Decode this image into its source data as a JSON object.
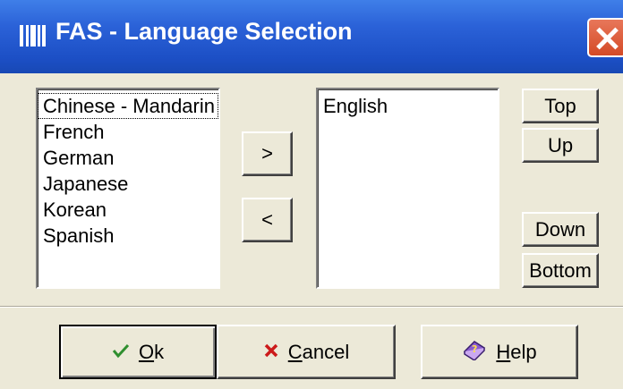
{
  "window": {
    "title": "FAS - Language Selection",
    "accent": "#2b62d8"
  },
  "available": {
    "items": [
      "Chinese - Mandarin",
      "French",
      "German",
      "Japanese",
      "Korean",
      "Spanish"
    ]
  },
  "selected": {
    "items": [
      "English"
    ]
  },
  "move": {
    "add_label": ">",
    "remove_label": "<"
  },
  "order": {
    "top_label": "Top",
    "up_label": "Up",
    "down_label": "Down",
    "bottom_label": "Bottom"
  },
  "footer": {
    "ok": {
      "label": "Ok",
      "icon": "checkmark-icon",
      "mnemonic": "O"
    },
    "cancel": {
      "label": "Cancel",
      "icon": "x-icon",
      "mnemonic": "C"
    },
    "help": {
      "label": "Help",
      "icon": "help-book-icon",
      "mnemonic": "H"
    }
  }
}
